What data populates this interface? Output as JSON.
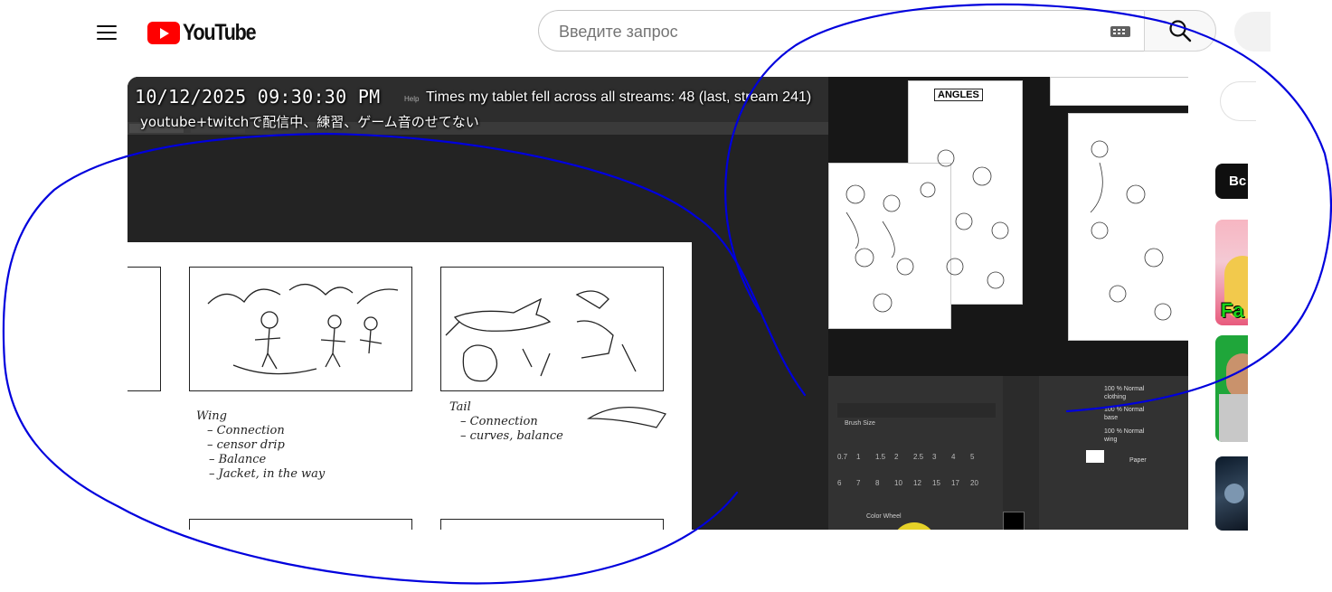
{
  "header": {
    "logo_text": "YouTube",
    "search_placeholder": "Введите запрос"
  },
  "video": {
    "timestamp": "10/12/2025 09:30:30 PM",
    "counter_text": "Times my tablet fell across all streams: 48 (last, stream 241)",
    "subtitle": "youtube+twitchで配信中、練習、ゲーム音のせてない",
    "app_menu_help": "Help",
    "sketch_title": "ANGLES",
    "notes": {
      "wing": [
        "Wing",
        "– Connection",
        "– censor drip",
        "– Balance",
        "– Jacket, in the way"
      ],
      "tail": [
        "Tail",
        "– Connection",
        "– curves, balance"
      ]
    },
    "layers": [
      "100 % Normal clothing",
      "100 % Normal base",
      "100 % Normal wing",
      "Paper"
    ],
    "brush_size_label": "Brush Size",
    "color_wheel_label": "Color Wheel",
    "brush_sizes": [
      "0.7",
      "1",
      "1.5",
      "2",
      "2.5",
      "3",
      "4",
      "5",
      "6",
      "7",
      "8",
      "10",
      "12",
      "15",
      "17",
      "20"
    ]
  },
  "sidebar": {
    "chip_label": "Вс",
    "thumb_text": "Fa"
  },
  "colors": {
    "annotation_ink": "#0000dd",
    "youtube_red": "#ff0000"
  }
}
